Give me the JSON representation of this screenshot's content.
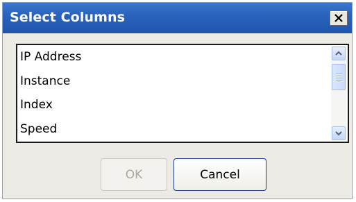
{
  "dialog": {
    "title": "Select Columns",
    "close_icon": "close-x-icon"
  },
  "columns_list": {
    "items": [
      {
        "label": "IP Address"
      },
      {
        "label": "Instance"
      },
      {
        "label": "Index"
      },
      {
        "label": "Speed"
      }
    ],
    "scroll_up_icon": "chevron-up-icon",
    "scroll_down_icon": "chevron-down-icon"
  },
  "buttons": {
    "ok_label": "OK",
    "ok_disabled": true,
    "cancel_label": "Cancel"
  },
  "colors": {
    "titlebar": "#2a63bd",
    "dialog_bg": "#ecebe6",
    "button_focus_border": "#1e3a8a"
  }
}
